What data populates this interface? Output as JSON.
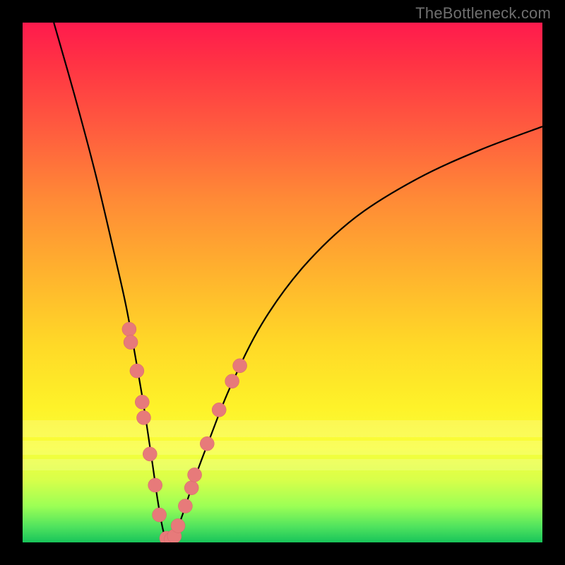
{
  "watermark": "TheBottleneck.com",
  "colors": {
    "dot_fill": "#e77a7a",
    "dot_stroke": "#d46868",
    "curve": "#000000"
  },
  "chart_data": {
    "type": "line",
    "title": "",
    "xlabel": "",
    "ylabel": "",
    "xlim": [
      0,
      100
    ],
    "ylim": [
      0,
      100
    ],
    "grid": false,
    "legend": false,
    "series": [
      {
        "name": "curve",
        "x": [
          6,
          10,
          14,
          18,
          20,
          22,
          23.5,
          25,
          26,
          27,
          27.7,
          28.5,
          29.5,
          31,
          33,
          36,
          40,
          46,
          54,
          64,
          76,
          88,
          100
        ],
        "y": [
          100,
          86,
          71,
          54,
          45,
          34,
          25,
          15,
          8,
          2.5,
          0.6,
          0.6,
          2,
          6,
          12,
          20,
          30,
          42,
          53,
          62.5,
          70,
          75.5,
          80
        ]
      }
    ],
    "annotations": {
      "dots": [
        {
          "x": 20.5,
          "y": 41
        },
        {
          "x": 20.8,
          "y": 38.5
        },
        {
          "x": 22.0,
          "y": 33
        },
        {
          "x": 23.0,
          "y": 27
        },
        {
          "x": 23.3,
          "y": 24
        },
        {
          "x": 24.5,
          "y": 17
        },
        {
          "x": 25.5,
          "y": 11
        },
        {
          "x": 26.3,
          "y": 5.3
        },
        {
          "x": 27.7,
          "y": 0.8
        },
        {
          "x": 28.6,
          "y": 0.6
        },
        {
          "x": 29.2,
          "y": 1.2
        },
        {
          "x": 29.9,
          "y": 3.2
        },
        {
          "x": 31.3,
          "y": 7.0
        },
        {
          "x": 32.5,
          "y": 10.5
        },
        {
          "x": 33.1,
          "y": 13.0
        },
        {
          "x": 35.5,
          "y": 19.0
        },
        {
          "x": 37.8,
          "y": 25.5
        },
        {
          "x": 40.3,
          "y": 31.0
        },
        {
          "x": 41.8,
          "y": 34.0
        }
      ],
      "light_bands_y": [
        76.5,
        80.5,
        84.0
      ]
    }
  }
}
